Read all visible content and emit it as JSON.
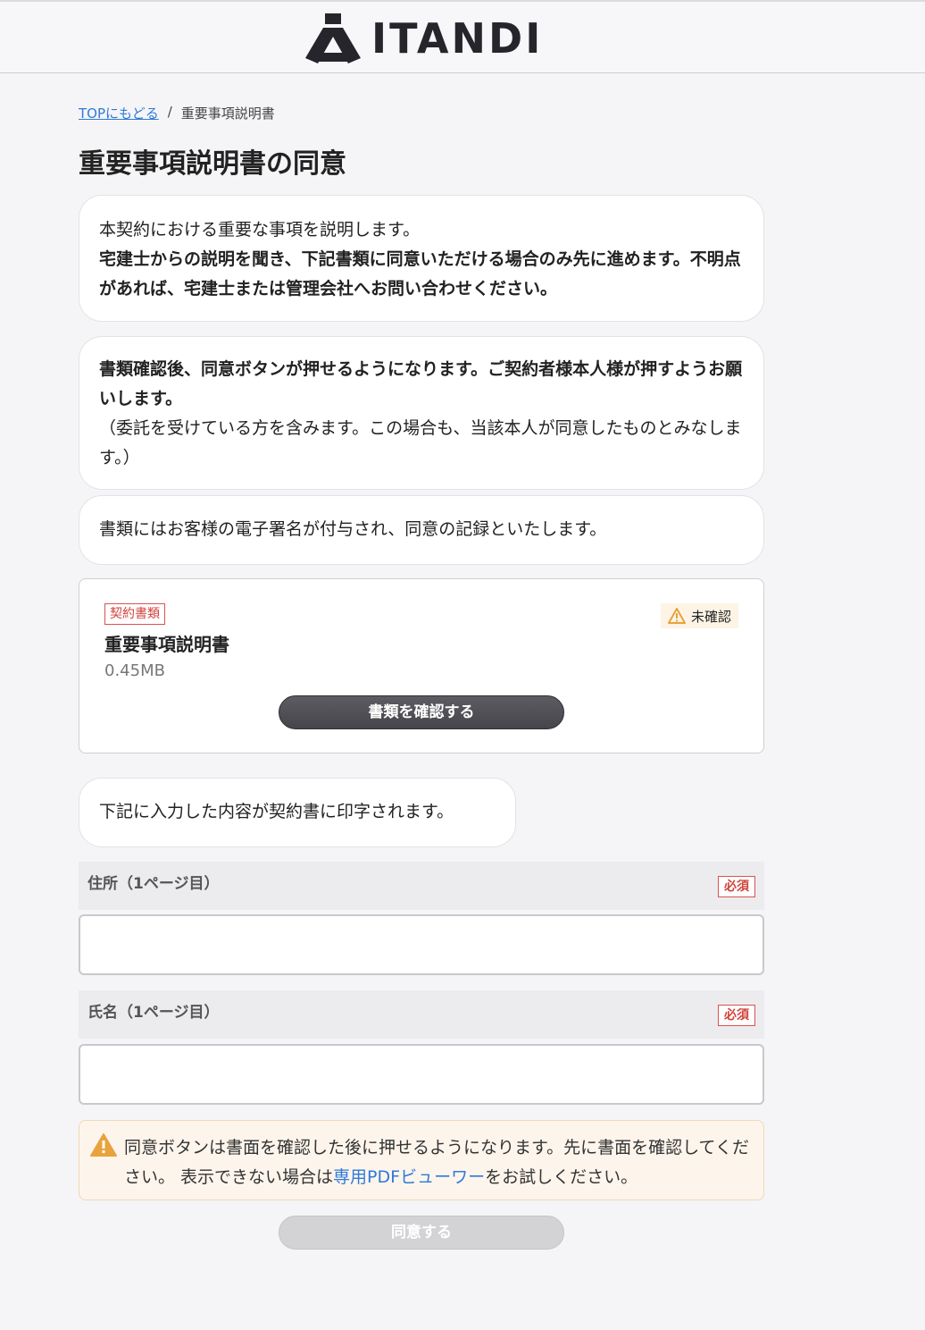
{
  "header": {
    "logo_text": "ITANDI"
  },
  "breadcrumb": {
    "top_link": "TOPにもどる",
    "separator": "/",
    "current": "重要事項説明書"
  },
  "page_title": "重要事項説明書の同意",
  "notice1": {
    "line1": "本契約における重要な事項を説明します。",
    "bold": "宅建士からの説明を聞き、下記書類に同意いただける場合のみ先に進めます。不明点があれば、宅建士または管理会社へお問い合わせください。"
  },
  "notice2": {
    "bold": "書類確認後、同意ボタンが押せるようになります。ご契約者様本人様が押すようお願いします。",
    "normal": "（委託を受けている方を含みます。この場合も、当該本人が同意したものとみなします。）"
  },
  "notice3": {
    "text": "書類にはお客様の電子署名が付与され、同意の記録といたします。"
  },
  "document": {
    "tag": "契約書類",
    "title": "重要事項説明書",
    "size": "0.45MB",
    "status": "未確認",
    "confirm_button": "書類を確認する"
  },
  "print_notice": "下記に入力した内容が契約書に印字されます。",
  "fields": [
    {
      "label": "住所（1ページ目）",
      "required": "必須",
      "value": ""
    },
    {
      "label": "氏名（1ページ目）",
      "required": "必須",
      "value": ""
    }
  ],
  "warning": {
    "text1": "同意ボタンは書面を確認した後に押せるようになります。先に書面を確認してください。 表示できない場合は",
    "link": "専用PDFビューワー",
    "text2": "をお試しください。"
  },
  "agree_button": "同意する",
  "colors": {
    "link": "#2f7ad8",
    "required_red": "#d0433c",
    "warning_orange": "#e8a33d"
  }
}
